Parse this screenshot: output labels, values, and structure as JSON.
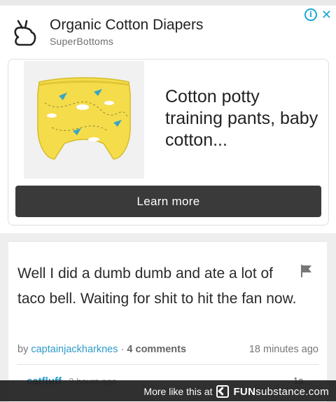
{
  "ad": {
    "title": "Organic Cotton Diapers",
    "advertiser": "SuperBottoms",
    "headline": "Cotton potty training pants, baby cotton...",
    "cta_label": "Learn more",
    "adchoices_icon": "info-icon",
    "close_icon": "close-icon",
    "accent_color": "#1aa7d6"
  },
  "post": {
    "text": "Well I did a dumb dumb and ate a lot of taco bell. Waiting for shit to hit the fan now.",
    "by_label": "by",
    "author": "captainjackharknes",
    "separator": "·",
    "comments": "4 comments",
    "time": "18 minutes ago",
    "flag_icon": "flag-icon",
    "peek_author": "catfluff",
    "peek_time": "2 hours ago",
    "peek_right": "1a."
  },
  "footer": {
    "more_like_this": "More like this at",
    "brand_bold": "FUN",
    "brand_rest": "substance.com"
  }
}
